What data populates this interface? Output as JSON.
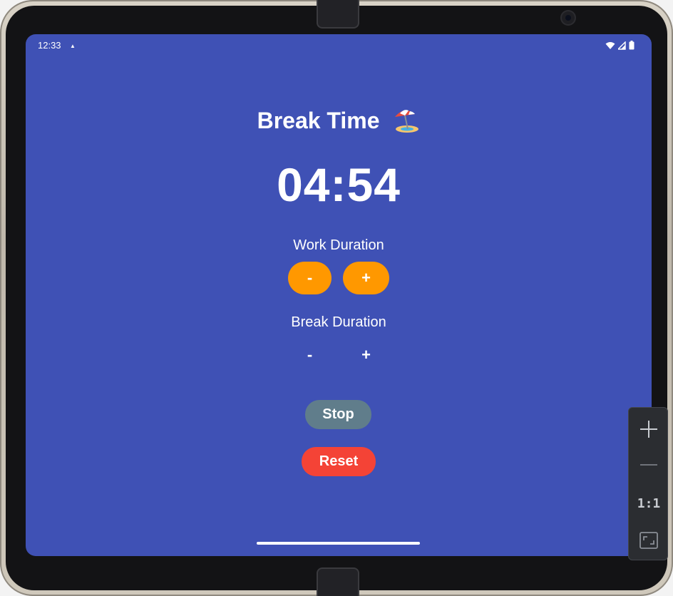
{
  "status_bar": {
    "time": "12:33"
  },
  "app": {
    "title": "Break Time",
    "timer": "04:54",
    "work_duration_label": "Work Duration",
    "work_minus": "-",
    "work_plus": "+",
    "break_duration_label": "Break Duration",
    "break_minus": "-",
    "break_plus": "+",
    "stop_label": "Stop",
    "reset_label": "Reset"
  },
  "emulator_controls": {
    "zoom_reset_label": "1:1",
    "icons": [
      "zoom-in-icon",
      "zoom-out-icon",
      "fit-to-screen-icon"
    ]
  },
  "colors": {
    "background": "#3f51b5",
    "orange_button": "#ff9800",
    "stop_button": "#607d8b",
    "reset_button": "#f44336"
  }
}
